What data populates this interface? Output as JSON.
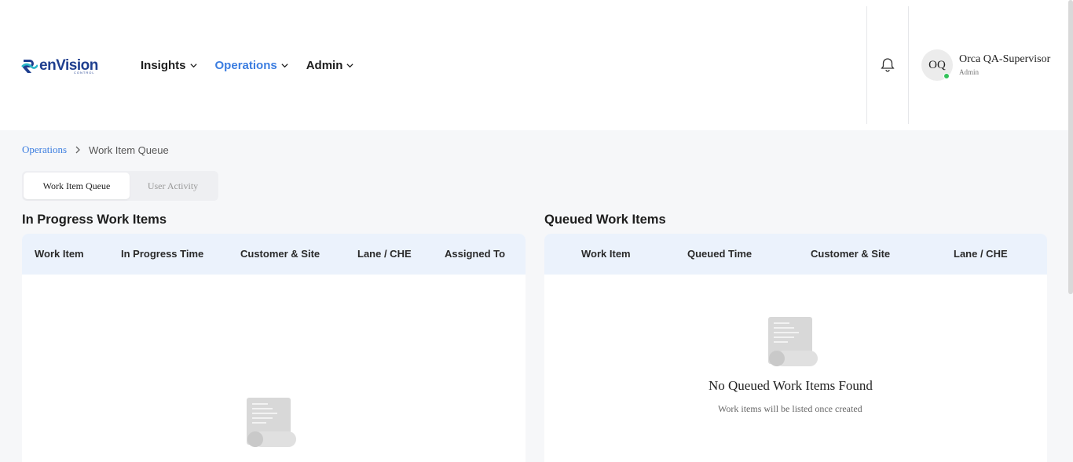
{
  "header": {
    "logo_text": "enVision",
    "logo_sub": "CONTROL",
    "nav": [
      {
        "label": "Insights"
      },
      {
        "label": "Operations"
      },
      {
        "label": "Admin"
      }
    ],
    "user": {
      "initials": "OQ",
      "name": "Orca QA-Supervisor",
      "role": "Admin",
      "status_color": "#33c25a"
    }
  },
  "breadcrumb": {
    "parent": "Operations",
    "current": "Work Item Queue"
  },
  "tabs": [
    {
      "label": "Work Item Queue"
    },
    {
      "label": "User Activity"
    }
  ],
  "in_progress": {
    "title": "In Progress Work Items",
    "columns": [
      "Work Item",
      "In Progress Time",
      "Customer & Site",
      "Lane / CHE",
      "Assigned To"
    ]
  },
  "queued": {
    "title": "Queued Work Items",
    "columns": [
      "Work Item",
      "Queued Time",
      "Customer & Site",
      "Lane / CHE"
    ],
    "empty_title": "No Queued Work Items Found",
    "empty_subtitle": "Work items will be listed once created"
  },
  "colors": {
    "accent": "#3b7de0",
    "header_bg": "#ebf2fc",
    "page_bg": "#f6f7f9"
  }
}
